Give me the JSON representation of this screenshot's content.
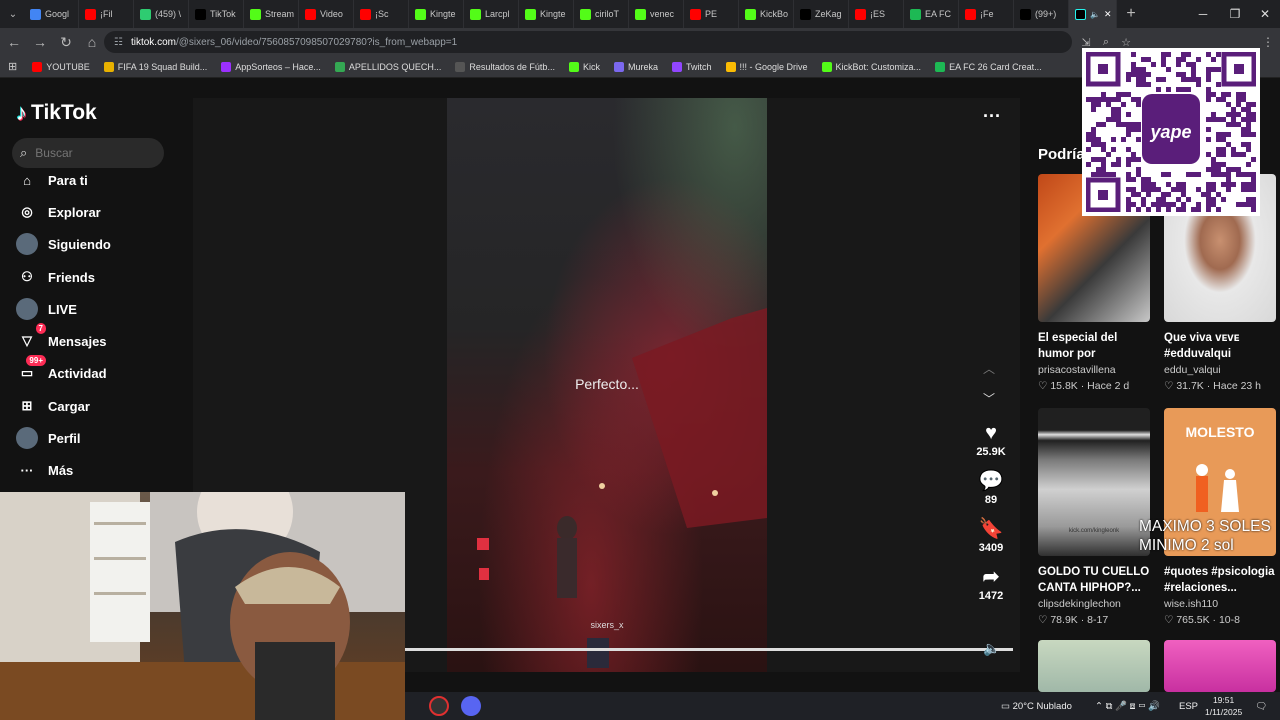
{
  "browser": {
    "tabs": [
      {
        "label": "Googl",
        "color": "#4285f4"
      },
      {
        "label": "¡Fil",
        "color": "#ff0000"
      },
      {
        "label": "(459) \\",
        "color": "#2ecc71"
      },
      {
        "label": "TikTok",
        "color": "#000000"
      },
      {
        "label": "Stream",
        "color": "#53fc18"
      },
      {
        "label": "Video",
        "color": "#ff0000"
      },
      {
        "label": "¡Sc",
        "color": "#ff0000"
      },
      {
        "label": "Kingte",
        "color": "#53fc18"
      },
      {
        "label": "Larcpl",
        "color": "#53fc18"
      },
      {
        "label": "Kingte",
        "color": "#53fc18"
      },
      {
        "label": "ciriloT",
        "color": "#53fc18"
      },
      {
        "label": "venec",
        "color": "#53fc18"
      },
      {
        "label": "PE",
        "color": "#ff0000"
      },
      {
        "label": "KickBo",
        "color": "#53fc18"
      },
      {
        "label": "ZeKag",
        "color": "#000000"
      },
      {
        "label": "¡ES",
        "color": "#ff0000"
      },
      {
        "label": "EA FC",
        "color": "#1db954"
      },
      {
        "label": "¡Fe",
        "color": "#ff0000"
      },
      {
        "label": "(99+)",
        "color": "#000000"
      }
    ],
    "url_host": "tiktok.com",
    "url_path": "/@sixers_06/video/7560857098507029780?is_from_webapp=1",
    "bookmarks": [
      {
        "label": "YOUTUBE",
        "color": "#ff0000"
      },
      {
        "label": "FIFA 19 Squad Build...",
        "color": "#e8b100"
      },
      {
        "label": "AppSorteos – Hace...",
        "color": "#9b30ff"
      },
      {
        "label": "APELLIDOS QUECH...",
        "color": "#34a853"
      },
      {
        "label": "Resultados de Fútb...",
        "color": "#555555"
      },
      {
        "label": "Kick",
        "color": "#53fc18"
      },
      {
        "label": "Mureka",
        "color": "#7b68ee"
      },
      {
        "label": "Twitch",
        "color": "#9146ff"
      },
      {
        "label": "!!! - Google Drive",
        "color": "#fbbc04"
      },
      {
        "label": "KickBot: Customiza...",
        "color": "#53fc18"
      },
      {
        "label": "EA FC 26 Card Creat...",
        "color": "#1db954"
      }
    ]
  },
  "tiktok": {
    "logo": "TikTok",
    "search_placeholder": "Buscar",
    "nav": [
      {
        "label": "Para ti",
        "icon": "home-icon"
      },
      {
        "label": "Explorar",
        "icon": "compass-icon"
      },
      {
        "label": "Siguiendo",
        "icon": "following-icon"
      },
      {
        "label": "Friends",
        "icon": "friends-icon"
      },
      {
        "label": "LIVE",
        "icon": "live-icon"
      },
      {
        "label": "Mensajes",
        "icon": "messages-icon",
        "badge": "7"
      },
      {
        "label": "Actividad",
        "icon": "activity-icon",
        "badge": "99+"
      },
      {
        "label": "Cargar",
        "icon": "upload-icon"
      },
      {
        "label": "Perfil",
        "icon": "profile-icon"
      },
      {
        "label": "Más",
        "icon": "more-icon"
      }
    ],
    "video": {
      "caption_overlay": "Perfecto...",
      "watermark": "sixers_x",
      "likes": "25.9K",
      "comments": "89",
      "saves": "3409",
      "shares": "1472"
    },
    "recommend_title": "Podría",
    "recommendations": [
      {
        "title": "El especial del humor por halloween...",
        "author": "prisacostavillena",
        "likes": "15.8K",
        "time": "Hace 2 d"
      },
      {
        "title": "Que viva ᴠᴇᴠᴇ #edduvalqui",
        "author": "eddu_valqui",
        "likes": "31.7K",
        "time": "Hace 23 h"
      },
      {
        "title": "GOLDO TU CUELLO CANTA HIPHOP?...",
        "author": "clipsdekinglechon",
        "likes": "78.9K",
        "time": "8-17"
      },
      {
        "title": "#quotes #psicologia #relaciones...",
        "author": "wise.ish110",
        "likes": "765.5K",
        "time": "10-8"
      }
    ],
    "thumb_text_molesto": "MOLESTO",
    "thumb_text_kick": "kick.com/kingleonk"
  },
  "overlay": {
    "qr_brand": "yape",
    "text_line1": "MAXIMO 3 SOLES",
    "text_line2": "MINIMO 2 sol"
  },
  "taskbar": {
    "weather": "20°C  Nublado",
    "lang": "ESP",
    "time": "19:51",
    "date": "1/11/2025"
  }
}
